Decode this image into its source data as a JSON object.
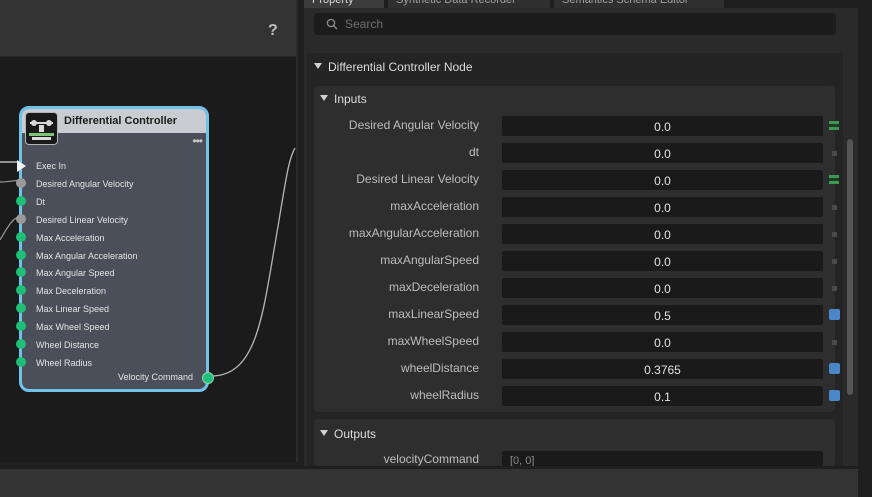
{
  "graph": {
    "help_label": "?",
    "node": {
      "title": "Differential Controller",
      "menu_label": "•••",
      "inputs": [
        {
          "label": "Exec In",
          "pin": "exec"
        },
        {
          "label": "Desired Angular Velocity",
          "pin": "grey"
        },
        {
          "label": "Dt",
          "pin": "green"
        },
        {
          "label": "Desired Linear Velocity",
          "pin": "grey"
        },
        {
          "label": "Max Acceleration",
          "pin": "green"
        },
        {
          "label": "Max Angular Acceleration",
          "pin": "green"
        },
        {
          "label": "Max Angular Speed",
          "pin": "green"
        },
        {
          "label": "Max Deceleration",
          "pin": "green"
        },
        {
          "label": "Max Linear Speed",
          "pin": "green"
        },
        {
          "label": "Max Wheel Speed",
          "pin": "green"
        },
        {
          "label": "Wheel Distance",
          "pin": "green"
        },
        {
          "label": "Wheel Radius",
          "pin": "green"
        }
      ],
      "output": {
        "label": "Velocity Command"
      }
    }
  },
  "tabs": [
    {
      "label": "Property",
      "active": true
    },
    {
      "label": "Synthetic Data Recorder",
      "active": false
    },
    {
      "label": "Semantics Schema Editor",
      "active": false
    }
  ],
  "search": {
    "placeholder": "Search"
  },
  "property_panel": {
    "node_section": "Differential Controller Node",
    "inputs_section": "Inputs",
    "outputs_section": "Outputs",
    "inputs": [
      {
        "label": "Desired Angular Velocity",
        "value": "0.0",
        "indicator": "connected"
      },
      {
        "label": "dt",
        "value": "0.0",
        "indicator": "default"
      },
      {
        "label": "Desired Linear Velocity",
        "value": "0.0",
        "indicator": "connected"
      },
      {
        "label": "maxAcceleration",
        "value": "0.0",
        "indicator": "default"
      },
      {
        "label": "maxAngularAcceleration",
        "value": "0.0",
        "indicator": "default"
      },
      {
        "label": "maxAngularSpeed",
        "value": "0.0",
        "indicator": "default"
      },
      {
        "label": "maxDeceleration",
        "value": "0.0",
        "indicator": "default"
      },
      {
        "label": "maxLinearSpeed",
        "value": "0.5",
        "indicator": "modified"
      },
      {
        "label": "maxWheelSpeed",
        "value": "0.0",
        "indicator": "default"
      },
      {
        "label": "wheelDistance",
        "value": "0.3765",
        "indicator": "modified"
      },
      {
        "label": "wheelRadius",
        "value": "0.1",
        "indicator": "modified"
      }
    ],
    "outputs": [
      {
        "label": "velocityCommand",
        "value": "[0, 0]"
      }
    ]
  },
  "colors": {
    "node_border": "#6fc3e8",
    "pin_green": "#1fbf7a",
    "pin_grey": "#9a9a9a",
    "indicator_connected": "#3a9a52",
    "indicator_modified": "#4a86c8",
    "indicator_default": "#4a4a4a"
  },
  "icons": {
    "search": "search-icon",
    "node_icon": "controller-node-icon",
    "collapse": "triangle-down-icon",
    "help": "help-icon"
  }
}
